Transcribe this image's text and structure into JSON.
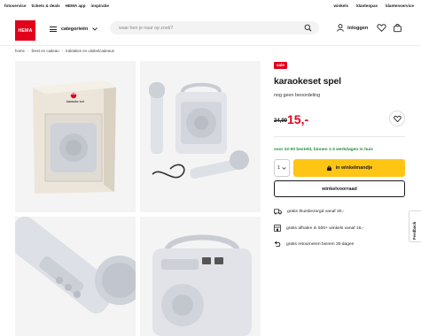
{
  "topbar": {
    "left_links": [
      "fotoservice",
      "tickets & deals",
      "HEMA app",
      "inspiratie"
    ],
    "right_links": [
      "winkels",
      "klantenpas",
      "klantenservice"
    ]
  },
  "header": {
    "logo_text": "HEMA",
    "categories_label": "categorieën",
    "search_placeholder": "waar ben je naar op zoek?",
    "login_label": "inloggen"
  },
  "breadcrumb": [
    "home",
    "feest en cadeau",
    "traktaties en uitdeelcadeaus"
  ],
  "gallery": {
    "box_label": "karaoke set",
    "box_logo": "HEMA"
  },
  "product": {
    "badge": "sale",
    "title": "karaokeset spel",
    "rating_text": "nog geen beoordeling",
    "old_price": "24,99",
    "new_price": "15,-",
    "delivery_text": "voor 22:00 besteld, binnen 1-3 werkdagen in huis",
    "quantity": "1",
    "add_to_cart_label": "in winkelmandje",
    "store_stock_label": "winkelvoorraad"
  },
  "usps": [
    {
      "icon": "truck-icon",
      "text": "gratis thuisbezorgd vanaf 30,-"
    },
    {
      "icon": "store-icon",
      "text": "gratis afhalen in 500+ winkels vanaf 15,-"
    },
    {
      "icon": "return-icon",
      "text": "gratis retourneren binnen 30 dagen"
    }
  ],
  "feedback_label": "Feedback",
  "colors": {
    "brand_red": "#e3001b",
    "cart_yellow": "#ffc514",
    "delivery_green": "#1f8c3b"
  }
}
